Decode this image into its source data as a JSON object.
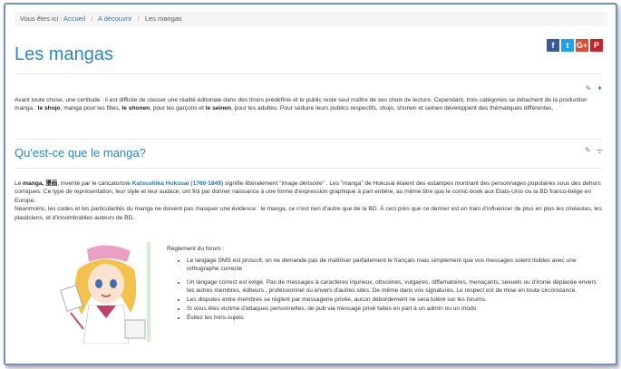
{
  "breadcrumb": {
    "prefix": "Vous êtes ici :",
    "items": [
      "Accueil",
      "A découvrir",
      "Les mangas"
    ]
  },
  "social": {
    "facebook": "f",
    "twitter": "t",
    "googleplus": "G+",
    "pinterest": "P"
  },
  "page_title": "Les mangas",
  "intro": {
    "t1": "Avant toute chose, une certitude : il est difficile de classer une réalité éditoriale dans des tiroirs prédéfinis et le public reste seul maître de ses choix de lecture. Cependant, trois catégories se détachent de la production manga : ",
    "b1": "le shojo",
    "t2": ", manga pour les filles, ",
    "b2": "le shonen",
    "t3": ", pour les garçons et ",
    "b3": "le seinen",
    "t4": ", pour les adultes. Pour séduire leurs publics respectifs, shojo, shonen et seinen développent des thématiques différentes."
  },
  "section": {
    "title": "Qu'est-ce que le manga?",
    "p1_t1": "Le ",
    "p1_b1": "manga, 漫画",
    "p1_t2": ", inventé par le caricaturiste ",
    "p1_link": "Katsushika Hokusai (1760-1849)",
    "p1_t3": " signifie littéralement \"image dérisoire\" . Les \"manga\" de Hokusai étaient des estampes montrant des personnages populaires sous des dehors comiques. Ce type de représentation, leur style et leur audace, ont fini par donner naissance à une forme d'expression graphique à part entière, au même titre que le comic-book aux Etats-Unis ou la BD franco-belge en Europe.",
    "p2": "Néanmoins, les codes et les particularités du manga ne doivent pas masquer une évidence : le manga, ce n'est rien d'autre que de la BD. À ceci près que ce dernier est en train d'influencer de plus en plus les cinéastes, les plasticiens, et d'innombrables auteurs de BD."
  },
  "forum_rules": {
    "heading": "Règlement du forum :",
    "items": [
      "Le langage SMS est proscrit, on ne demande pas de maîtriser parfaitement le français mais simplement que vos messages soient lisibles avec une orthographe correcte",
      "Un langage correct est exigé. Pas de messages à caractères injurieux, obscènes, vulgaires, diffamatoires, menaçants, sexuels ou d'ironie déplacée envers les autres membres, éditeurs , professionnel ou envers d'autres sites. De même dans vos signatures. Le respect est de mise en toute circonstance.",
      "Les disputes entre membres se règlent par messagerie privée, aucun débordement ne sera toléré sur les forums.",
      "Si vous êtes victime d'attaques personnelles, de pub via message privé faites en part à un admin ou un modo",
      "Évitez les hors-sujets."
    ]
  }
}
